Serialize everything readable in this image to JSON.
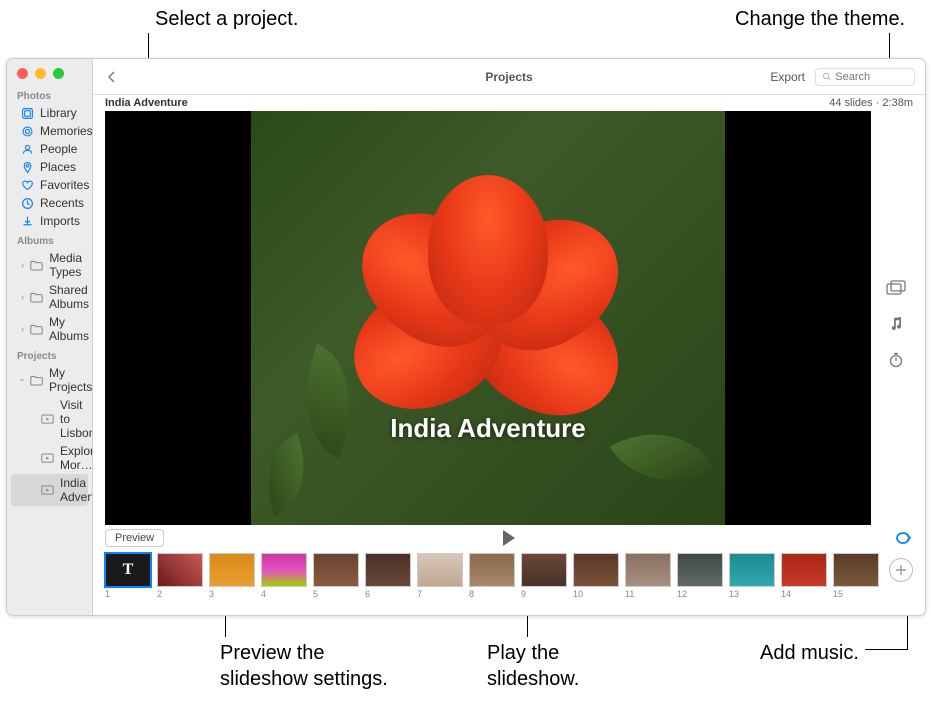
{
  "annotations": {
    "select_project": "Select a project.",
    "change_theme": "Change the theme.",
    "preview_settings": "Preview the\nslideshow settings.",
    "play_slideshow": "Play the\nslideshow.",
    "add_music": "Add music."
  },
  "window": {
    "toolbar": {
      "title": "Projects",
      "export": "Export",
      "search_placeholder": "Search"
    },
    "subheader": {
      "project_name": "India Adventure",
      "info": "44 slides · 2:38m"
    },
    "stage": {
      "overlay_title": "India Adventure"
    },
    "controls": {
      "preview": "Preview"
    }
  },
  "sidebar": {
    "sections": {
      "photos": "Photos",
      "albums": "Albums",
      "projects": "Projects"
    },
    "photos": [
      {
        "label": "Library"
      },
      {
        "label": "Memories"
      },
      {
        "label": "People"
      },
      {
        "label": "Places"
      },
      {
        "label": "Favorites"
      },
      {
        "label": "Recents"
      },
      {
        "label": "Imports"
      }
    ],
    "albums": [
      {
        "label": "Media Types"
      },
      {
        "label": "Shared Albums"
      },
      {
        "label": "My Albums"
      }
    ],
    "projects_root": "My Projects",
    "projects": [
      {
        "label": "Visit to Lisbon"
      },
      {
        "label": "Exploring Mor…"
      },
      {
        "label": "India Adventure"
      }
    ]
  },
  "thumbnails": [
    {
      "n": "1"
    },
    {
      "n": "2"
    },
    {
      "n": "3"
    },
    {
      "n": "4"
    },
    {
      "n": "5"
    },
    {
      "n": "6"
    },
    {
      "n": "7"
    },
    {
      "n": "8"
    },
    {
      "n": "9"
    },
    {
      "n": "10"
    },
    {
      "n": "11"
    },
    {
      "n": "12"
    },
    {
      "n": "13"
    },
    {
      "n": "14"
    },
    {
      "n": "15"
    }
  ]
}
